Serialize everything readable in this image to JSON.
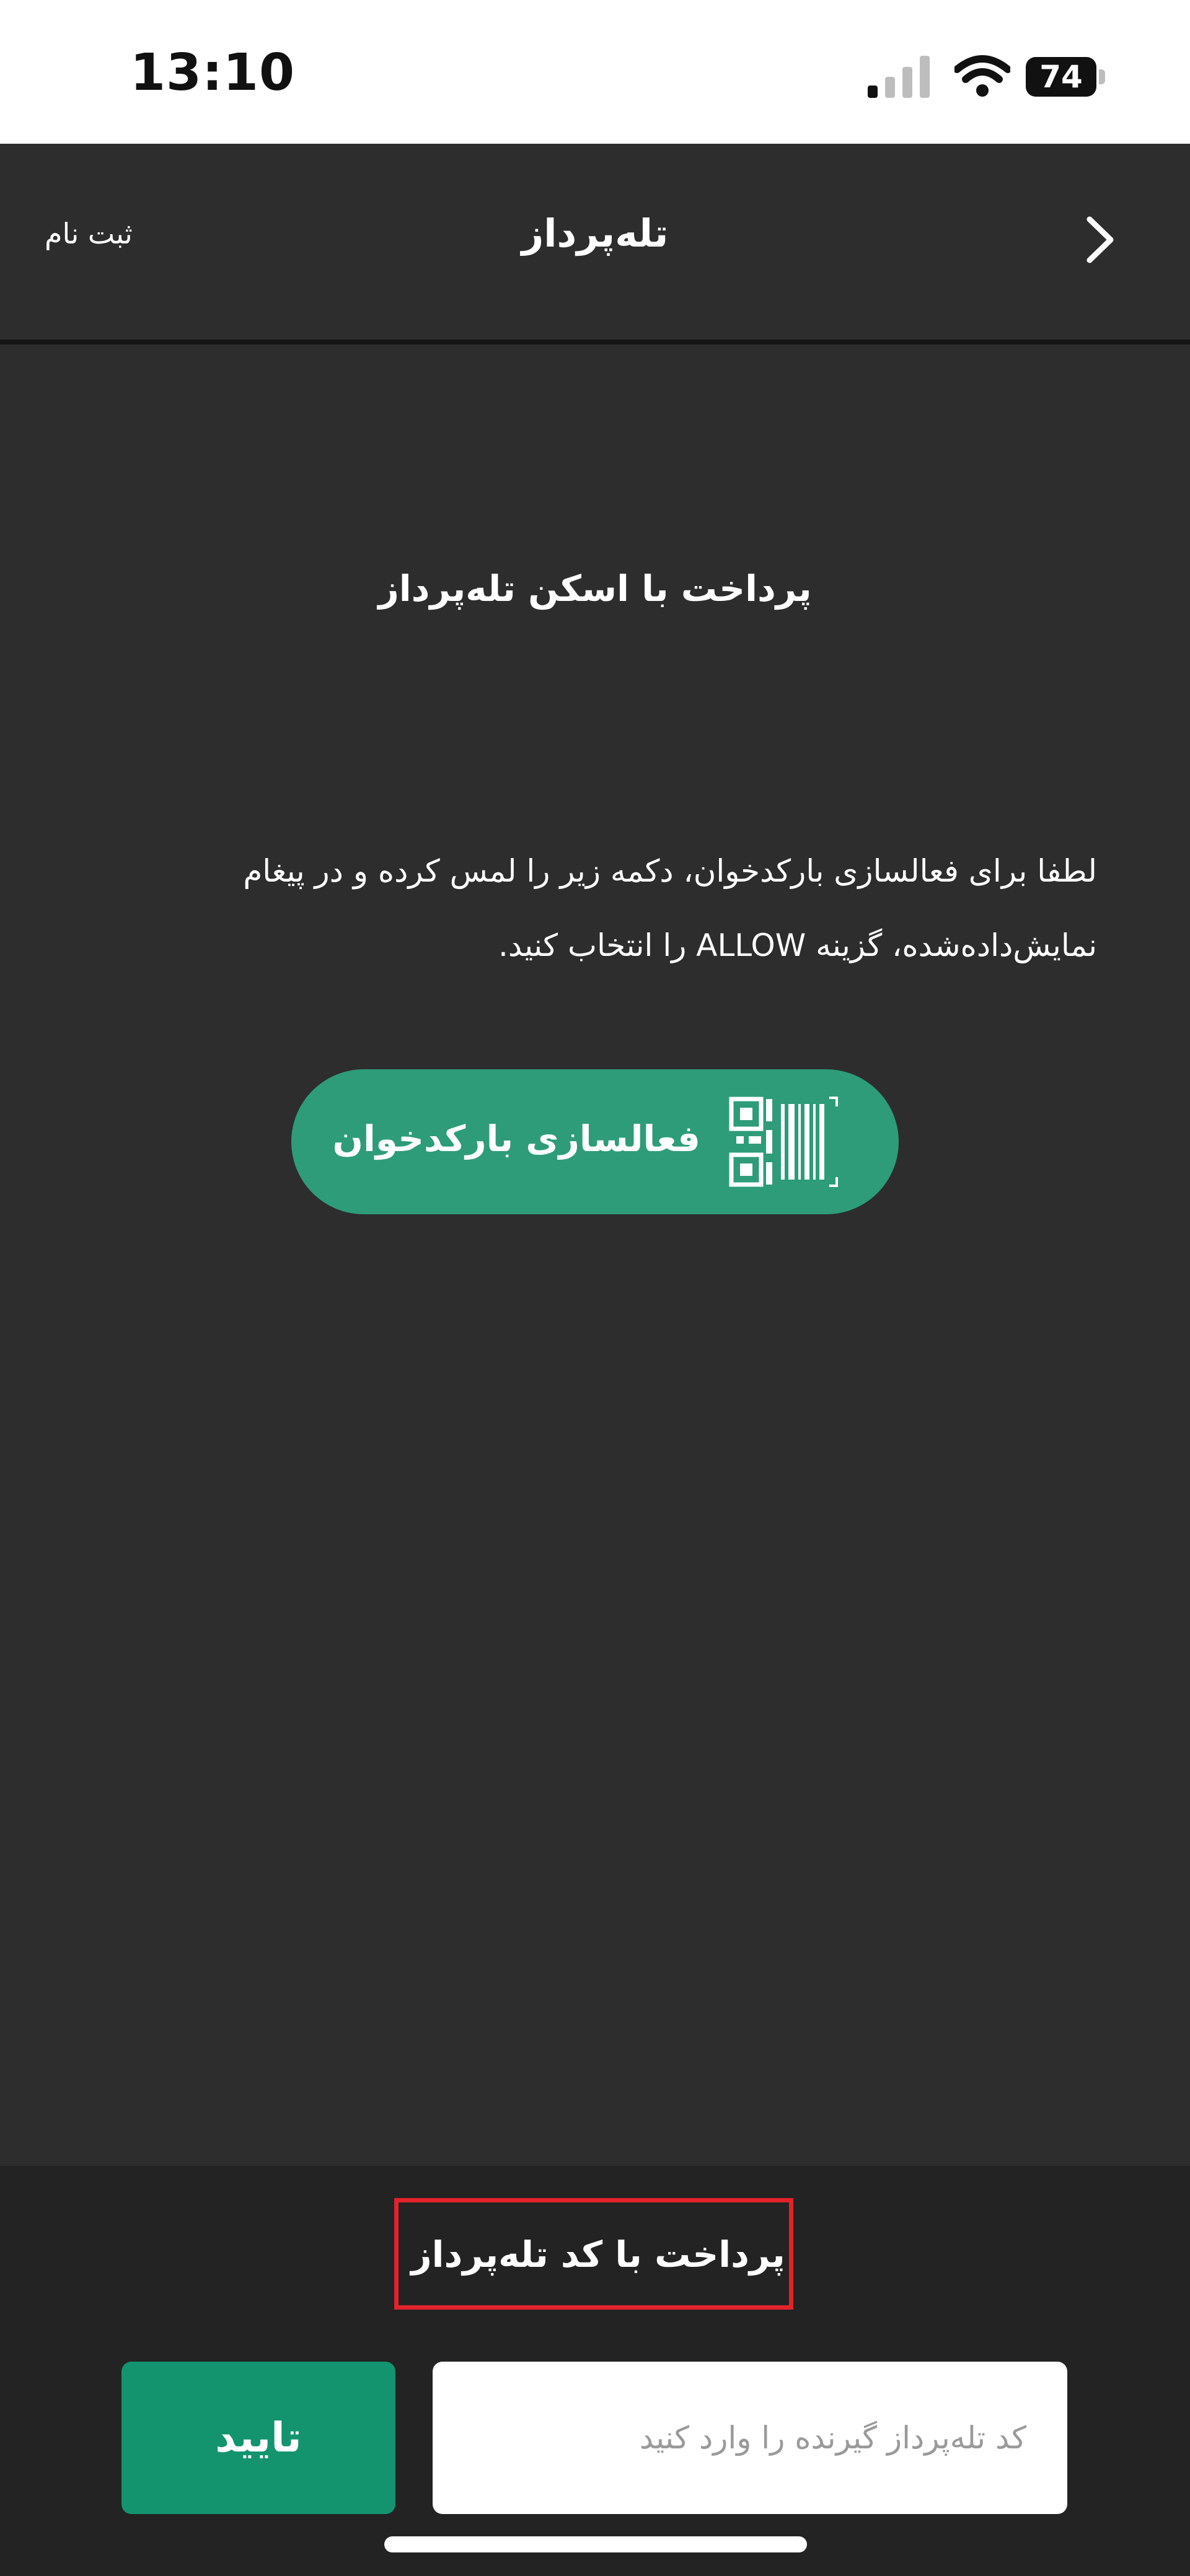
{
  "status_bar": {
    "time": "13:10",
    "battery_level": "74",
    "signal_icon": "cellular-signal-icon",
    "wifi_icon": "wifi-icon"
  },
  "header": {
    "title": "تله‌پرداز",
    "register_label": "ثبت نام",
    "back_icon": "chevron-right-icon"
  },
  "scan_section": {
    "title": "پرداخت با اسکن تله‌پرداز",
    "instruction_lines": [
      "لطفا برای فعالسازی بارکدخوان، دکمه زیر را لمس کرده و در پیغام",
      "نمایش‌داده‌شده، گزینه ALLOW را انتخاب کنید."
    ],
    "activate_button_label": "فعالسازی بارکدخوان",
    "barcode_icon": "qr-barcode-icon"
  },
  "code_section": {
    "title": "پرداخت با کد تله‌پرداز",
    "input_placeholder": "کد تله‌پرداز گیرنده را وارد کنید",
    "input_value": "",
    "confirm_label": "تایید"
  },
  "colors": {
    "accent_green": "#2e9c78",
    "confirm_green": "#13946e",
    "highlight_red": "#e3222b",
    "background": "#2d2d2d"
  }
}
